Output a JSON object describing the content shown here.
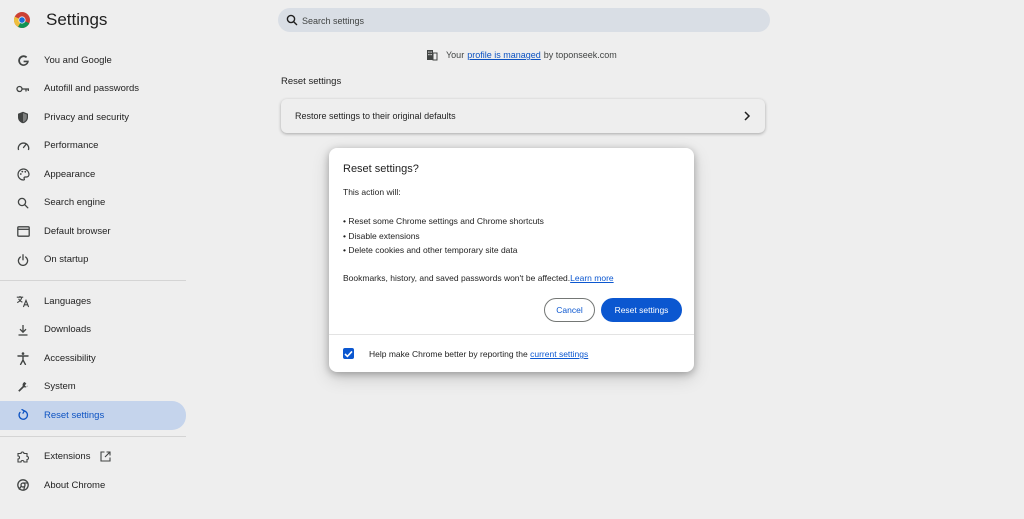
{
  "app": {
    "title": "Settings"
  },
  "search": {
    "placeholder": "Search settings"
  },
  "sidebar": {
    "items": [
      {
        "label": "You and Google",
        "icon": "google-g-icon"
      },
      {
        "label": "Autofill and passwords",
        "icon": "key-icon"
      },
      {
        "label": "Privacy and security",
        "icon": "shield-icon"
      },
      {
        "label": "Performance",
        "icon": "speedometer-icon"
      },
      {
        "label": "Appearance",
        "icon": "palette-icon"
      },
      {
        "label": "Search engine",
        "icon": "search-icon"
      },
      {
        "label": "Default browser",
        "icon": "browser-window-icon"
      },
      {
        "label": "On startup",
        "icon": "power-icon"
      },
      {
        "label": "Languages",
        "icon": "translate-icon"
      },
      {
        "label": "Downloads",
        "icon": "download-icon"
      },
      {
        "label": "Accessibility",
        "icon": "accessibility-icon"
      },
      {
        "label": "System",
        "icon": "wrench-icon"
      },
      {
        "label": "Reset settings",
        "icon": "reset-icon",
        "active": true
      }
    ],
    "extensions": {
      "label": "Extensions",
      "icon": "puzzle-icon"
    },
    "about": {
      "label": "About Chrome",
      "icon": "chrome-icon"
    }
  },
  "managed": {
    "prefix": "Your",
    "link": "profile is managed",
    "suffix": "by toponseek.com"
  },
  "main": {
    "section_title": "Reset settings",
    "card_label": "Restore settings to their original defaults"
  },
  "dialog": {
    "title": "Reset settings?",
    "intro": "This action will:",
    "bullets": [
      "• Reset some Chrome settings and Chrome shortcuts",
      "• Disable extensions",
      "• Delete cookies and other temporary site data"
    ],
    "note": "Bookmarks, history, and saved passwords won't be affected.",
    "learn_more": "Learn more",
    "cancel_label": "Cancel",
    "reset_label": "Reset settings",
    "footer_text": "Help make Chrome better by reporting the",
    "footer_link": "current settings",
    "checkbox_checked": true
  },
  "colors": {
    "accent": "#0b57d0",
    "active_bg": "#d3e3fd",
    "search_bg": "#e9eef6"
  }
}
